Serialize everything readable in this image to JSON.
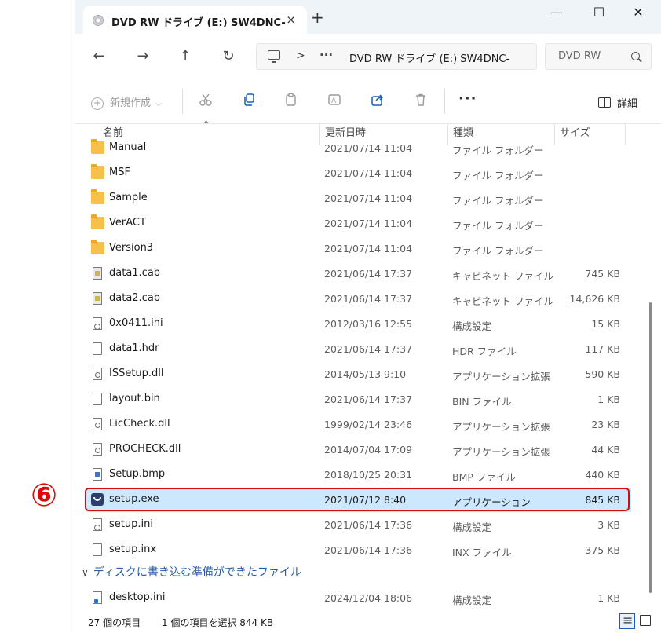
{
  "window": {
    "tab_title": "DVD RW ドライブ (E:) SW4DNC-",
    "tab_close": "×",
    "new_tab": "+",
    "minimize": "—",
    "maximize": "☐",
    "close": "✕"
  },
  "nav": {
    "back": "←",
    "forward": "→",
    "up": "↑",
    "refresh": "↻",
    "address_sep": ">",
    "address_overflow": "···",
    "address_path": "DVD RW ドライブ (E:) SW4DNC-",
    "search_placeholder": "DVD RW"
  },
  "toolbar": {
    "new_label": "新規作成",
    "new_plus": "+",
    "new_chevron": "⌵",
    "more": "···",
    "details_label": "詳細"
  },
  "columns": {
    "name": "名前",
    "date": "更新日時",
    "type": "種類",
    "size": "サイズ"
  },
  "files": [
    {
      "name": "Manual",
      "date": "2021/07/14 11:04",
      "type": "ファイル フォルダー",
      "size": "",
      "icon": "folder-icon"
    },
    {
      "name": "MSF",
      "date": "2021/07/14 11:04",
      "type": "ファイル フォルダー",
      "size": "",
      "icon": "folder-icon"
    },
    {
      "name": "Sample",
      "date": "2021/07/14 11:04",
      "type": "ファイル フォルダー",
      "size": "",
      "icon": "folder-icon"
    },
    {
      "name": "VerACT",
      "date": "2021/07/14 11:04",
      "type": "ファイル フォルダー",
      "size": "",
      "icon": "folder-icon"
    },
    {
      "name": "Version3",
      "date": "2021/07/14 11:04",
      "type": "ファイル フォルダー",
      "size": "",
      "icon": "folder-icon"
    },
    {
      "name": "data1.cab",
      "date": "2021/06/14 17:37",
      "type": "キャビネット ファイル",
      "size": "745 KB",
      "icon": "cabinet-file-icon"
    },
    {
      "name": "data2.cab",
      "date": "2021/06/14 17:37",
      "type": "キャビネット ファイル",
      "size": "14,626 KB",
      "icon": "cabinet-file-icon"
    },
    {
      "name": "0x0411.ini",
      "date": "2012/03/16 12:55",
      "type": "構成設定",
      "size": "15 KB",
      "icon": "settings-file-icon"
    },
    {
      "name": "data1.hdr",
      "date": "2021/06/14 17:37",
      "type": "HDR ファイル",
      "size": "117 KB",
      "icon": "file-icon"
    },
    {
      "name": "ISSetup.dll",
      "date": "2014/05/13 9:10",
      "type": "アプリケーション拡張",
      "size": "590 KB",
      "icon": "dll-file-icon"
    },
    {
      "name": "layout.bin",
      "date": "2021/06/14 17:37",
      "type": "BIN ファイル",
      "size": "1 KB",
      "icon": "file-icon"
    },
    {
      "name": "LicCheck.dll",
      "date": "1999/02/14 23:46",
      "type": "アプリケーション拡張",
      "size": "23 KB",
      "icon": "dll-file-icon"
    },
    {
      "name": "PROCHECK.dll",
      "date": "2014/07/04 17:09",
      "type": "アプリケーション拡張",
      "size": "44 KB",
      "icon": "dll-file-icon"
    },
    {
      "name": "Setup.bmp",
      "date": "2018/10/25 20:31",
      "type": "BMP ファイル",
      "size": "440 KB",
      "icon": "bitmap-file-icon"
    },
    {
      "name": "setup.exe",
      "date": "2021/07/12 8:40",
      "type": "アプリケーション",
      "size": "845 KB",
      "icon": "setup-exe-icon"
    },
    {
      "name": "setup.ini",
      "date": "2021/06/14 17:36",
      "type": "構成設定",
      "size": "3 KB",
      "icon": "settings-file-icon"
    },
    {
      "name": "setup.inx",
      "date": "2021/06/14 17:36",
      "type": "INX ファイル",
      "size": "375 KB",
      "icon": "file-icon"
    }
  ],
  "group": {
    "chevron": "∨",
    "label": "ディスクに書き込む準備ができたファイル",
    "files": [
      {
        "name": "desktop.ini",
        "date": "2024/12/04 18:06",
        "type": "構成設定",
        "size": "1 KB",
        "icon": "desktop-ini-icon"
      }
    ]
  },
  "status": {
    "item_count": "27 個の項目",
    "selection": "1 個の項目を選択  844 KB"
  },
  "annotation": {
    "step_number": "⑥",
    "color": "#d80b0b"
  },
  "colors": {
    "selection": "#cce8ff",
    "folder": "#f6c04a",
    "group_header": "#2a5fa8"
  }
}
